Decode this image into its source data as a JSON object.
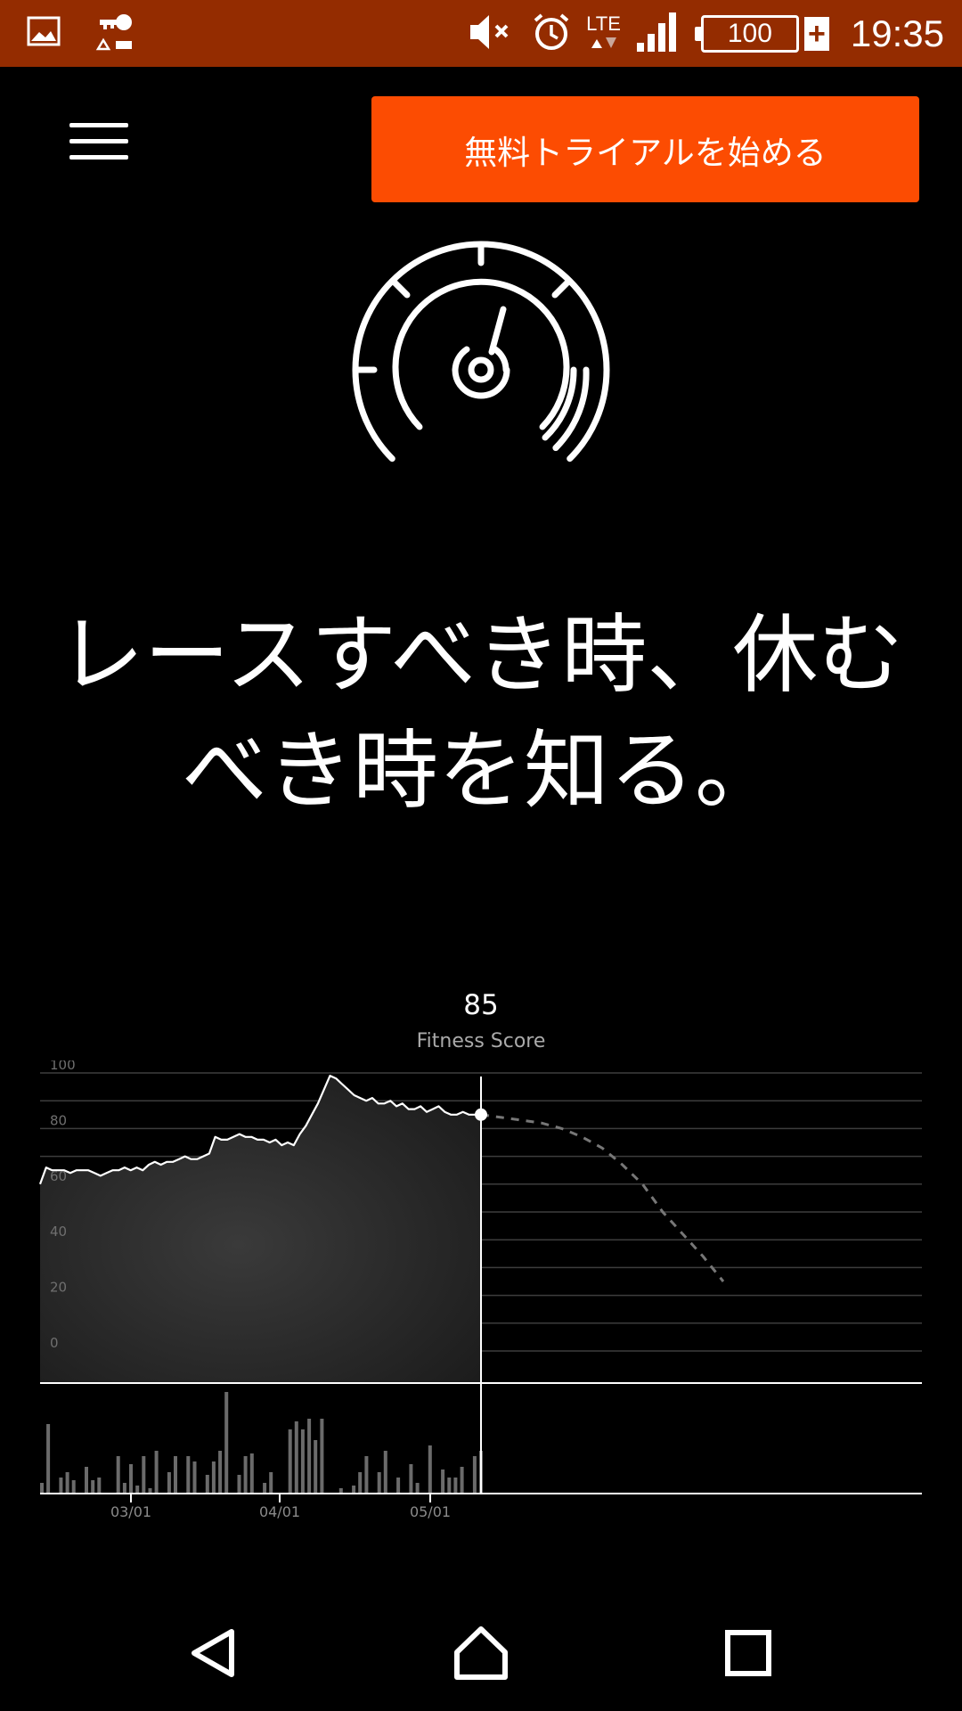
{
  "status_bar": {
    "time": "19:35",
    "battery": "100",
    "battery_charging": "+",
    "network": "LTE",
    "icons": [
      "image-icon",
      "vpn-key-icon",
      "mute-icon",
      "alarm-icon",
      "lte-icon",
      "signal-icon",
      "battery-icon"
    ]
  },
  "header": {
    "menu_icon": "hamburger-menu-icon",
    "trial_button": "無料トライアルを始める"
  },
  "hero": {
    "icon": "speedometer-icon",
    "headline_line1": "レースすべき時、休む",
    "headline_line2": "べき時を知る。"
  },
  "score": {
    "value": "85",
    "label": "Fitness Score"
  },
  "chart_data": {
    "type": "area",
    "ylim": [
      0,
      100
    ],
    "y_ticks": [
      "100",
      "80",
      "60",
      "40",
      "20",
      "0"
    ],
    "x_ticks": [
      "03/01",
      "04/01",
      "05/01"
    ],
    "series": [
      {
        "values": [
          60,
          66,
          65,
          65,
          65,
          64,
          65,
          65,
          65,
          64,
          63,
          64,
          65,
          65,
          66,
          65,
          66,
          65,
          67,
          68,
          67,
          68,
          68,
          69,
          70,
          69,
          69,
          70,
          71,
          77,
          76,
          76,
          77,
          78,
          77,
          77,
          76,
          76,
          75,
          76,
          74,
          75,
          74,
          78,
          81,
          85,
          89,
          94,
          99,
          98,
          96,
          94,
          92,
          91,
          90,
          91,
          89,
          89,
          90,
          88,
          89,
          87,
          87,
          88,
          86,
          87,
          88,
          86,
          85,
          85,
          86,
          85,
          85,
          85
        ]
      }
    ],
    "projection": [
      85,
      84,
      83,
      82,
      80,
      77,
      73,
      67,
      60,
      50,
      42,
      34,
      25
    ],
    "bars": [
      4,
      26,
      0,
      6,
      8,
      5,
      0,
      10,
      5,
      6,
      0,
      0,
      14,
      4,
      11,
      3,
      14,
      2,
      16,
      0,
      8,
      14,
      0,
      14,
      12,
      0,
      7,
      12,
      16,
      38,
      0,
      7,
      14,
      15,
      0,
      4,
      8,
      0,
      0,
      24,
      27,
      24,
      28,
      20,
      28,
      0,
      0,
      2,
      0,
      3,
      8,
      14,
      0,
      8,
      16,
      0,
      6,
      0,
      11,
      4,
      0,
      18,
      0,
      9,
      6,
      6,
      10,
      0,
      14,
      16
    ],
    "current_value": 85
  },
  "nav": {
    "back_icon": "back-triangle-icon",
    "home_icon": "home-icon",
    "recents_icon": "recents-square-icon"
  }
}
